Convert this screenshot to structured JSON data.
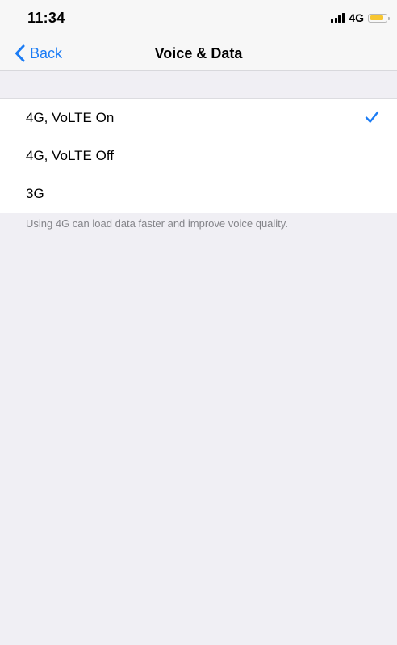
{
  "status_bar": {
    "time": "11:34",
    "network": "4G",
    "signal_icon": "cellular-signal-icon",
    "battery_icon": "battery-icon",
    "battery_color": "#f7c631"
  },
  "nav": {
    "back_label": "Back",
    "back_icon": "chevron-left-icon",
    "title": "Voice & Data",
    "accent_color": "#1b7cf5"
  },
  "options": [
    {
      "label": "4G, VoLTE On",
      "selected": true
    },
    {
      "label": "4G, VoLTE Off",
      "selected": false
    },
    {
      "label": "3G",
      "selected": false
    }
  ],
  "footer": {
    "note": "Using 4G can load data faster and improve voice quality."
  }
}
